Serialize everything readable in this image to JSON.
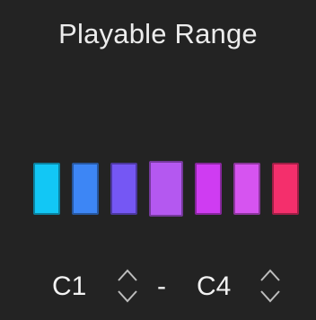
{
  "title": "Playable Range",
  "keys": [
    {
      "color": "#12c7f5",
      "highlighted": false
    },
    {
      "color": "#3d86f5",
      "highlighted": false
    },
    {
      "color": "#7557f4",
      "highlighted": false
    },
    {
      "color": "#b458f0",
      "highlighted": true
    },
    {
      "color": "#cf3cf2",
      "highlighted": false
    },
    {
      "color": "#d654f0",
      "highlighted": false
    },
    {
      "color": "#f42f6c",
      "highlighted": false
    }
  ],
  "range": {
    "low": "C1",
    "separator": "-",
    "high": "C4",
    "stepper_icon": "up-down-chevron-icon"
  }
}
